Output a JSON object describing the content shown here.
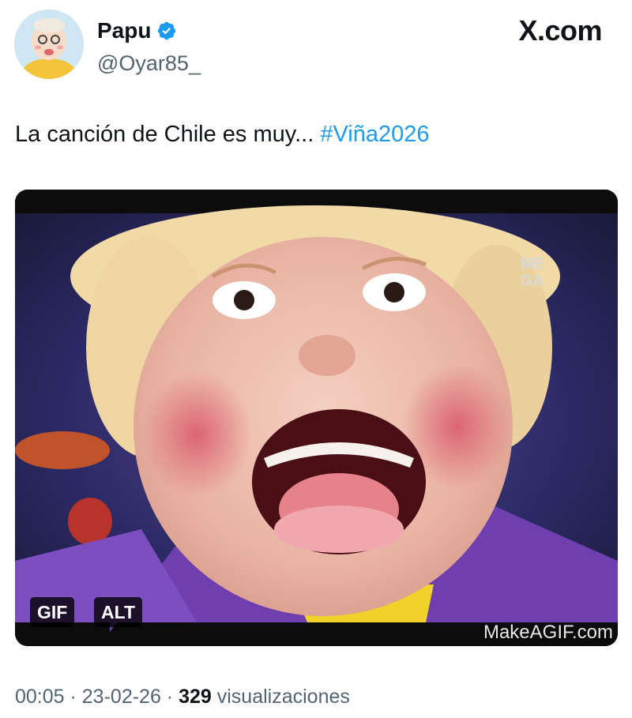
{
  "author": {
    "display_name": "Papu",
    "handle": "@Oyar85_",
    "verified": true,
    "avatar_icon": "cartoon-avatar"
  },
  "brand": {
    "label": "X.com"
  },
  "tweet": {
    "text": "La canción de Chile es muy... ",
    "hashtag": "#Viña2026"
  },
  "media": {
    "gif_badge": "GIF",
    "alt_badge": "ALT",
    "watermark": "MakeAGIF.com"
  },
  "meta": {
    "time": "00:05",
    "separator": " · ",
    "date": "23-02-26",
    "views_count": "329",
    "views_label": " visualizaciones"
  },
  "colors": {
    "link": "#1d9bf0",
    "secondary_text": "#536471",
    "primary_text": "#0f1419"
  }
}
